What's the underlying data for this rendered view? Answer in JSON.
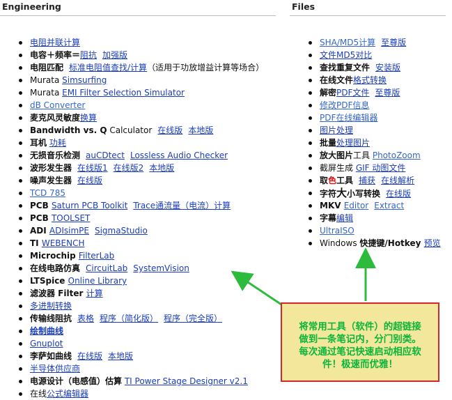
{
  "engineering": {
    "title": "Engineering",
    "items": [
      [
        {
          "t": "电阻并联计算",
          "s": "lnk"
        }
      ],
      [
        {
          "t": "电容＋频率＝",
          "s": "b"
        },
        {
          "t": "阻抗",
          "s": "lnk"
        },
        {
          "t": "gap",
          "s": "gap"
        },
        {
          "t": "加强版",
          "s": "lnk"
        }
      ],
      [
        {
          "t": "电阻匹配",
          "s": "b"
        },
        {
          "t": "gap",
          "s": "gap"
        },
        {
          "t": "标准电阻值查找/计算",
          "s": "lnk"
        },
        {
          "t": "（适用于功放增益计算等场合）",
          "s": ""
        }
      ],
      [
        {
          "t": "Murata ",
          "s": ""
        },
        {
          "t": "Simsurfing",
          "s": "lnk"
        }
      ],
      [
        {
          "t": "Murata ",
          "s": ""
        },
        {
          "t": "EMI Filter Selection Simulator",
          "s": "lnk"
        }
      ],
      [
        {
          "t": "dB Converter",
          "s": "lnk blue"
        }
      ],
      [
        {
          "t": "麦克风灵敏度",
          "s": "b"
        },
        {
          "t": "换算",
          "s": "lnk"
        }
      ],
      [
        {
          "t": "Bandwidth vs. Q",
          "s": "b"
        },
        {
          "t": " Calculator",
          "s": ""
        },
        {
          "t": "gap",
          "s": "gap"
        },
        {
          "t": "在线版",
          "s": "lnk"
        },
        {
          "t": "gap",
          "s": "gap"
        },
        {
          "t": "本地版",
          "s": "lnk"
        }
      ],
      [
        {
          "t": "耳机",
          "s": "b"
        },
        {
          "t": " ",
          "s": ""
        },
        {
          "t": "功耗",
          "s": "lnk"
        }
      ],
      [
        {
          "t": "无损音乐检测",
          "s": "b"
        },
        {
          "t": "gap",
          "s": "gap"
        },
        {
          "t": "auCDtect",
          "s": "lnk"
        },
        {
          "t": "gap",
          "s": "gap"
        },
        {
          "t": "Lossless Audio Checker",
          "s": "lnk"
        }
      ],
      [
        {
          "t": "波形发生器",
          "s": "b"
        },
        {
          "t": "gap",
          "s": "gap"
        },
        {
          "t": "在线版1",
          "s": "lnk"
        },
        {
          "t": "gap",
          "s": "gap"
        },
        {
          "t": "在线版2",
          "s": "lnk"
        },
        {
          "t": "gap",
          "s": "gap"
        },
        {
          "t": "本地版",
          "s": "lnk"
        }
      ],
      [
        {
          "t": "噪声发生器",
          "s": "b"
        },
        {
          "t": "gap",
          "s": "gap"
        },
        {
          "t": "在线版",
          "s": "lnk"
        }
      ],
      [
        {
          "t": "TCD 785",
          "s": "lnk blue"
        }
      ],
      [
        {
          "t": "PCB ",
          "s": "b"
        },
        {
          "t": "Saturn PCB Toolkit",
          "s": "lnk"
        },
        {
          "t": "gap",
          "s": "gap"
        },
        {
          "t": "Trace通流量（电流）计算",
          "s": "lnk"
        }
      ],
      [
        {
          "t": "PCB ",
          "s": "b"
        },
        {
          "t": "TOOLSET",
          "s": "lnk"
        }
      ],
      [
        {
          "t": "ADI ",
          "s": "b"
        },
        {
          "t": "ADIsimPE",
          "s": "lnk"
        },
        {
          "t": "gap",
          "s": "gap"
        },
        {
          "t": "SigmaStudio",
          "s": "lnk"
        }
      ],
      [
        {
          "t": "TI ",
          "s": "b"
        },
        {
          "t": "WEBENCH",
          "s": "lnk"
        }
      ],
      [
        {
          "t": "Microchip ",
          "s": "b"
        },
        {
          "t": "FilterLab",
          "s": "lnk"
        }
      ],
      [
        {
          "t": "在线电路仿真",
          "s": "b"
        },
        {
          "t": "gap",
          "s": "gap"
        },
        {
          "t": "CircuitLab",
          "s": "lnk"
        },
        {
          "t": "gap",
          "s": "gap"
        },
        {
          "t": "SystemVision",
          "s": "lnk"
        }
      ],
      [
        {
          "t": "LTSpice ",
          "s": "b"
        },
        {
          "t": "Online Library",
          "s": "lnk"
        }
      ],
      [
        {
          "t": "滤波器 Filter ",
          "s": "b"
        },
        {
          "t": "计算",
          "s": "lnk"
        }
      ],
      [
        {
          "t": "多进制转换",
          "s": "lnk"
        }
      ],
      [
        {
          "t": "传输线阻抗",
          "s": "b"
        },
        {
          "t": "gap",
          "s": "gap"
        },
        {
          "t": "表格",
          "s": "lnk"
        },
        {
          "t": "gap",
          "s": "gap"
        },
        {
          "t": "程序（简化版）",
          "s": "lnk"
        },
        {
          "t": "gap",
          "s": "gap"
        },
        {
          "t": "程序（完全版）",
          "s": "lnk"
        }
      ],
      [
        {
          "t": "绘制曲线",
          "s": "lnk b"
        }
      ],
      [
        {
          "t": "Gnuplot",
          "s": "lnk"
        }
      ],
      [
        {
          "t": "李萨如曲线",
          "s": "b"
        },
        {
          "t": "gap",
          "s": "gap"
        },
        {
          "t": "在线版",
          "s": "lnk"
        },
        {
          "t": "gap",
          "s": "gap"
        },
        {
          "t": "本地版",
          "s": "lnk"
        }
      ],
      [
        {
          "t": "半导体供应商",
          "s": "lnk"
        }
      ],
      [
        {
          "t": "电源设计（电感值）估算",
          "s": "b"
        },
        {
          "t": " ",
          "s": ""
        },
        {
          "t": "TI Power Stage Designer v2.1",
          "s": "lnk"
        }
      ],
      [
        {
          "t": "在线",
          "s": ""
        },
        {
          "t": "公式编辑器",
          "s": "lnk"
        }
      ]
    ]
  },
  "files": {
    "title": "Files",
    "items": [
      [
        {
          "t": "SHA/MD5计算",
          "s": "lnk blue"
        },
        {
          "t": "gap",
          "s": "gap"
        },
        {
          "t": "至尊版",
          "s": "lnk"
        }
      ],
      [
        {
          "t": "文件MD5对比",
          "s": "lnk"
        }
      ],
      [
        {
          "t": "查找重复文件",
          "s": "b"
        },
        {
          "t": "gap",
          "s": "gap"
        },
        {
          "t": "安装版",
          "s": "lnk"
        }
      ],
      [
        {
          "t": "在线文件",
          "s": "b"
        },
        {
          "t": "格式转换",
          "s": "lnk"
        }
      ],
      [
        {
          "t": "解密",
          "s": "b"
        },
        {
          "t": "PDF文件",
          "s": "lnk"
        },
        {
          "t": "gap",
          "s": "gap"
        },
        {
          "t": "至尊版",
          "s": "lnk"
        }
      ],
      [
        {
          "t": "修改PDF信息",
          "s": "lnk blue"
        }
      ],
      [
        {
          "t": "PDF在线编辑器",
          "s": "lnk blue"
        }
      ],
      [
        {
          "t": "图片处理",
          "s": "lnk"
        }
      ],
      [
        {
          "t": "批量",
          "s": "b"
        },
        {
          "t": "处理图片",
          "s": "lnk"
        }
      ],
      [
        {
          "t": "放大图片",
          "s": "b"
        },
        {
          "t": "工具 ",
          "s": ""
        },
        {
          "t": "PhotoZoom",
          "s": "lnk blue"
        }
      ],
      [
        {
          "t": "截屏生成 ",
          "s": ""
        },
        {
          "t": "GIF 动图文件",
          "s": "lnk"
        }
      ],
      [
        {
          "t": "取",
          "s": "b"
        },
        {
          "t": "色",
          "s": "red"
        },
        {
          "t": "工具",
          "s": "b"
        },
        {
          "t": "gap",
          "s": "gap"
        },
        {
          "t": "捕获",
          "s": "lnk"
        },
        {
          "t": "gap",
          "s": "gap"
        },
        {
          "t": "在线解析",
          "s": "lnk"
        }
      ],
      [
        {
          "t": "字符",
          "s": "b"
        },
        {
          "t": "大",
          "s": "big"
        },
        {
          "t": "小写转换",
          "s": "b"
        },
        {
          "t": "gap",
          "s": "gap"
        },
        {
          "t": "在线版",
          "s": "lnk"
        }
      ],
      [
        {
          "t": "MKV ",
          "s": "b"
        },
        {
          "t": "Editor",
          "s": "lnk blue"
        },
        {
          "t": "gap",
          "s": "gap"
        },
        {
          "t": "Extract",
          "s": "lnk blue"
        }
      ],
      [
        {
          "t": "字幕",
          "s": "b"
        },
        {
          "t": "编辑",
          "s": "lnk"
        }
      ],
      [
        {
          "t": "UltraISO",
          "s": "lnk blue"
        }
      ],
      [
        {
          "t": "Windows ",
          "s": ""
        },
        {
          "t": "快捷键/Hotkey ",
          "s": "b"
        },
        {
          "t": "预览",
          "s": "lnk"
        }
      ]
    ]
  },
  "callout": {
    "lines": [
      "将常用工具（软件）的超链接",
      "做到一条笔记内，分门别类。",
      "每次通过笔记快速启动相应软",
      "件！极速而优雅！"
    ]
  },
  "colors": {
    "link": "#1a3dbd",
    "callout_bg": "#f2e79a",
    "callout_border": "#d42828",
    "callout_text": "#0bb43a",
    "arrow": "#2dbb3e"
  }
}
